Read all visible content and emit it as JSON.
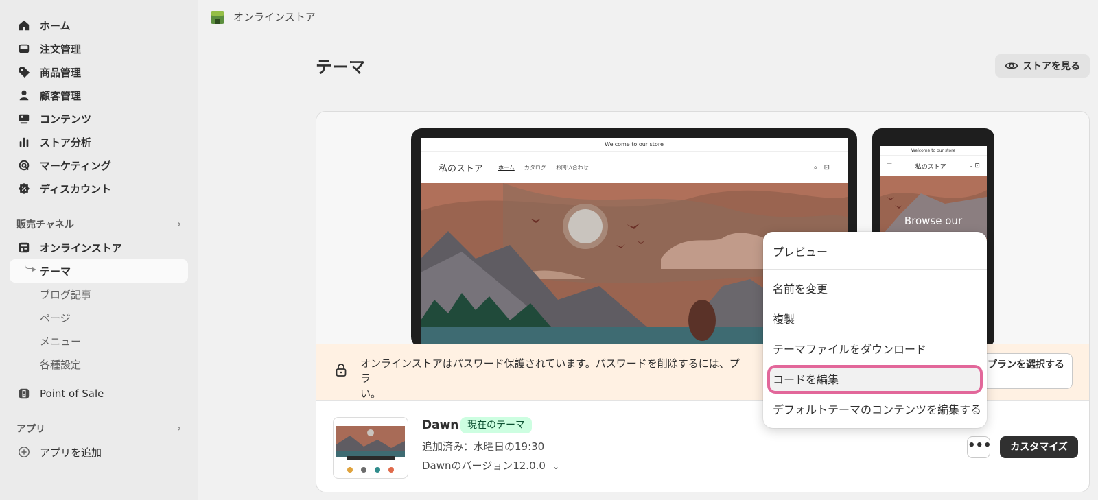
{
  "sidebar": {
    "nav": [
      {
        "label": "ホーム",
        "icon": "home-icon"
      },
      {
        "label": "注文管理",
        "icon": "orders-icon"
      },
      {
        "label": "商品管理",
        "icon": "tag-icon"
      },
      {
        "label": "顧客管理",
        "icon": "person-icon"
      },
      {
        "label": "コンテンツ",
        "icon": "content-icon"
      },
      {
        "label": "ストア分析",
        "icon": "analytics-icon"
      },
      {
        "label": "マーケティング",
        "icon": "marketing-icon"
      },
      {
        "label": "ディスカウント",
        "icon": "discount-icon"
      }
    ],
    "sales_channels_label": "販売チャネル",
    "online_store_label": "オンラインストア",
    "sub_items": [
      "テーマ",
      "ブログ記事",
      "ページ",
      "メニュー",
      "各種設定"
    ],
    "pos_label": "Point of Sale",
    "apps_label": "アプリ",
    "add_app_label": "アプリを追加"
  },
  "topbar": {
    "title": "オンラインストア"
  },
  "page": {
    "title": "テーマ",
    "view_store_label": "ストアを見る"
  },
  "preview": {
    "announcement": "Welcome to our store",
    "store_name": "私のストア",
    "nav_links": [
      "ホーム",
      "カタログ",
      "お問い合わせ"
    ],
    "phone_hero_text": "Browse our"
  },
  "banner": {
    "message": "オンラインストアはパスワード保護されています。パスワードを削除するには、プラ",
    "message_tail": "い。",
    "plan_button_label": "プランを選択する"
  },
  "theme": {
    "name": "Dawn",
    "badge": "現在のテーマ",
    "added": "追加済み：水曜日の19:30",
    "version": "Dawnのバージョン12.0.0",
    "more_label": "•••",
    "customize_label": "カスタマイズ"
  },
  "menu": {
    "items": [
      "プレビュー",
      "名前を変更",
      "複製",
      "テーマファイルをダウンロード",
      "コードを編集",
      "デフォルトテーマのコンテンツを編集する"
    ],
    "highlighted": "コードを編集"
  },
  "colors": {
    "highlight_border": "#e2679a",
    "badge_bg": "#cdfee1",
    "banner_bg": "#fff1e3",
    "primary_button": "#303030"
  }
}
